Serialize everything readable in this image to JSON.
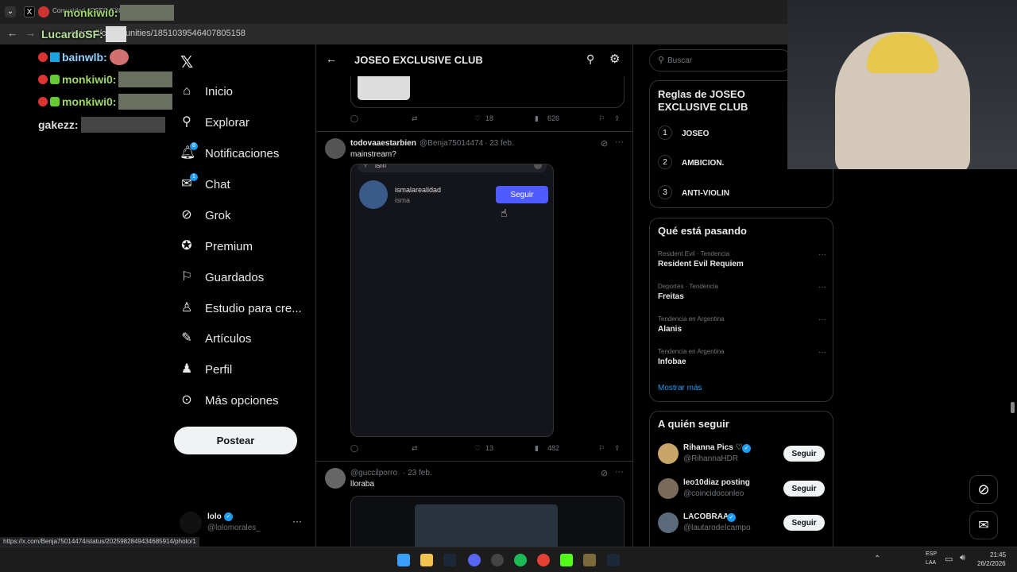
{
  "browser": {
    "tab_title": "Comunidad JOSEO EXCLUSIVE CLUB / X",
    "url": "x.com/i/communities/1851039546407805158",
    "status_url": "https://x.com/Benja75014474/status/2025982849434685914/photo/1"
  },
  "chat_overlay": [
    {
      "user": "monkiwi0:"
    },
    {
      "user": "LucardoSF:"
    },
    {
      "user": "bainwlb:"
    },
    {
      "user": "monkiwi0:"
    },
    {
      "user": "monkiwi0:"
    },
    {
      "user": "gakezz:"
    }
  ],
  "nav": {
    "items": [
      {
        "label": "Inicio",
        "icon": "home-icon"
      },
      {
        "label": "Explorar",
        "icon": "search-icon"
      },
      {
        "label": "Notificaciones",
        "icon": "bell-icon",
        "badge": "8"
      },
      {
        "label": "Chat",
        "icon": "mail-icon",
        "badge": "1"
      },
      {
        "label": "Grok",
        "icon": "grok-icon"
      },
      {
        "label": "Premium",
        "icon": "premium-icon"
      },
      {
        "label": "Guardados",
        "icon": "bookmark-icon"
      },
      {
        "label": "Estudio para cre...",
        "icon": "studio-icon"
      },
      {
        "label": "Artículos",
        "icon": "article-icon"
      },
      {
        "label": "Perfil",
        "icon": "person-icon"
      },
      {
        "label": "Más opciones",
        "icon": "more-icon"
      }
    ],
    "post_label": "Postear",
    "account": {
      "name": "lolo",
      "handle": "@lolomorales_"
    }
  },
  "community": {
    "title": "JOSEO EXCLUSIVE CLUB"
  },
  "tweets": [
    {
      "stats": {
        "replies": "",
        "retweets": "",
        "likes": "18",
        "views": "626"
      }
    },
    {
      "author": "todovaaestarbien",
      "handle": "@Benja75014474",
      "date": "· 23 feb.",
      "text": "mainstream?",
      "embed": {
        "search_text": "ism",
        "user_name": "ismalarealidad",
        "user_handle": "isma",
        "follow_label": "Seguir"
      },
      "stats": {
        "replies": "",
        "retweets": "",
        "likes": "13",
        "views": "482"
      }
    },
    {
      "handle": "@guccilporro",
      "date": "· 23 feb.",
      "text": "lloraba"
    }
  ],
  "right": {
    "search_placeholder": "Buscar",
    "rules_title": "Reglas de JOSEO EXCLUSIVE CLUB",
    "rules": [
      {
        "num": "1",
        "label": "JOSEO"
      },
      {
        "num": "2",
        "label": "AMBICION."
      },
      {
        "num": "3",
        "label": "ANTI-VIOLIN"
      }
    ],
    "trends_title": "Qué está pasando",
    "trends": [
      {
        "context": "Resident Evil · Tendencia",
        "name": "Resident Evil Requiem"
      },
      {
        "context": "Deportes · Tendencia",
        "name": "Freitas"
      },
      {
        "context": "Tendencia en Argentina",
        "name": "Alanis"
      },
      {
        "context": "Tendencia en Argentina",
        "name": "Infobae"
      }
    ],
    "show_more": "Mostrar más",
    "who_title": "A quién seguir",
    "who": [
      {
        "name": "Rihanna Pics ♡",
        "handle": "@RihannaHDR",
        "button": "Seguir"
      },
      {
        "name": "leo10diaz posting",
        "handle": "@coincidoconleo",
        "button": "Seguir"
      },
      {
        "name": "LACOBRAAA",
        "handle": "@lautarodeIcampo",
        "button": "Seguir"
      }
    ]
  },
  "taskbar": {
    "lang": "ESP",
    "lang2": "LAA",
    "time": "21:45",
    "date": "26/2/2026"
  },
  "colors": {
    "accent": "#1d9bf0",
    "follow_embed": "#4f5bff",
    "bg": "#000000",
    "border": "#2f3336"
  }
}
